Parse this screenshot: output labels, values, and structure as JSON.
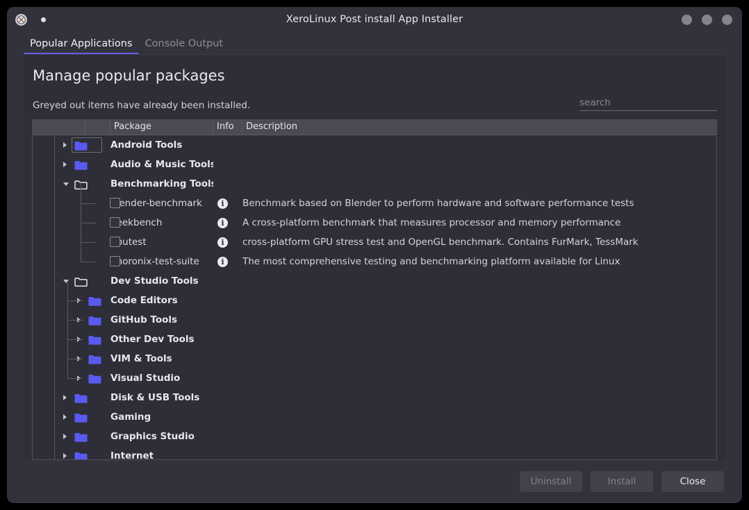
{
  "window": {
    "title": "XeroLinux Post install App Installer",
    "app_icon": "xerolinux-logo-icon",
    "controls": [
      "minimize-button",
      "maximize-button",
      "close-button"
    ]
  },
  "tabs": [
    {
      "label": "Popular Applications",
      "active": true
    },
    {
      "label": "Console Output",
      "active": false
    }
  ],
  "page": {
    "title": "Manage popular packages",
    "hint": "Greyed out items have already been installed."
  },
  "search": {
    "placeholder": "search",
    "value": ""
  },
  "table": {
    "headers": [
      "",
      "",
      "Package",
      "Info",
      "Description"
    ]
  },
  "rows": [
    {
      "type": "group",
      "depth": 0,
      "state": "collapsed",
      "icon": "folder-closed-icon",
      "name": "Android Tools",
      "info": "",
      "description": "",
      "focused": true
    },
    {
      "type": "group",
      "depth": 0,
      "state": "collapsed",
      "icon": "folder-closed-icon",
      "name": "Audio & Music Tools",
      "info": "",
      "description": ""
    },
    {
      "type": "group",
      "depth": 0,
      "state": "expanded",
      "icon": "folder-open-icon",
      "name": "Benchmarking Tools",
      "info": "",
      "description": ""
    },
    {
      "type": "item",
      "depth": 1,
      "checked": false,
      "icon": "checkbox-icon",
      "name": "blender-benchmark",
      "info": "info-icon",
      "description": "Benchmark based on Blender to perform hardware and software performance tests"
    },
    {
      "type": "item",
      "depth": 1,
      "checked": false,
      "icon": "checkbox-icon",
      "name": "geekbench",
      "info": "info-icon",
      "description": "A cross-platform benchmark that measures processor and memory performance"
    },
    {
      "type": "item",
      "depth": 1,
      "checked": false,
      "icon": "checkbox-icon",
      "name": "gputest",
      "info": "info-icon",
      "description": "cross-platform GPU stress test and OpenGL benchmark. Contains FurMark, TessMark"
    },
    {
      "type": "item",
      "depth": 1,
      "checked": false,
      "icon": "checkbox-icon",
      "name": "phoronix-test-suite",
      "info": "info-icon",
      "description": "The most comprehensive testing and benchmarking platform available for Linux"
    },
    {
      "type": "group",
      "depth": 0,
      "state": "expanded",
      "icon": "folder-open-icon",
      "name": "Dev Studio Tools",
      "info": "",
      "description": ""
    },
    {
      "type": "group",
      "depth": 1,
      "state": "collapsed",
      "icon": "folder-closed-icon",
      "name": "Code Editors",
      "info": "",
      "description": ""
    },
    {
      "type": "group",
      "depth": 1,
      "state": "collapsed",
      "icon": "folder-closed-icon",
      "name": "GitHub Tools",
      "info": "",
      "description": ""
    },
    {
      "type": "group",
      "depth": 1,
      "state": "collapsed",
      "icon": "folder-closed-icon",
      "name": "Other Dev Tools",
      "info": "",
      "description": ""
    },
    {
      "type": "group",
      "depth": 1,
      "state": "collapsed",
      "icon": "folder-closed-icon",
      "name": "VIM & Tools",
      "info": "",
      "description": ""
    },
    {
      "type": "group",
      "depth": 1,
      "state": "collapsed",
      "icon": "folder-closed-icon",
      "name": "Visual Studio",
      "info": "",
      "description": ""
    },
    {
      "type": "group",
      "depth": 0,
      "state": "collapsed",
      "icon": "folder-closed-icon",
      "name": "Disk & USB Tools",
      "info": "",
      "description": ""
    },
    {
      "type": "group",
      "depth": 0,
      "state": "collapsed",
      "icon": "folder-closed-icon",
      "name": "Gaming",
      "info": "",
      "description": ""
    },
    {
      "type": "group",
      "depth": 0,
      "state": "collapsed",
      "icon": "folder-closed-icon",
      "name": "Graphics Studio",
      "info": "",
      "description": ""
    },
    {
      "type": "group",
      "depth": 0,
      "state": "collapsed",
      "icon": "folder-closed-icon",
      "name": "Internet",
      "info": "",
      "description": ""
    }
  ],
  "footer": {
    "buttons": [
      {
        "label": "Uninstall",
        "enabled": false
      },
      {
        "label": "Install",
        "enabled": false
      },
      {
        "label": "Close",
        "enabled": true
      }
    ]
  },
  "colors": {
    "window_bg": "#32323c",
    "panel_bg": "#2e2e38",
    "header_row_bg": "#4a4a54",
    "accent": "#6c5ce7",
    "folder_blue": "#5a5af0",
    "text_primary": "#e8e8ec",
    "text_muted": "#8d8d99"
  }
}
